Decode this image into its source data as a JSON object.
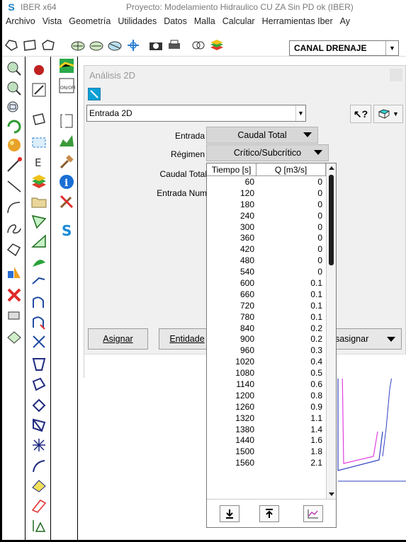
{
  "window": {
    "app_name": "IBER x64",
    "project_title": "Proyecto: Modelamiento Hidraulico CU ZA Sin PD ok (IBER)"
  },
  "menu": [
    "Archivo",
    "Vista",
    "Geometría",
    "Utilidades",
    "Datos",
    "Malla",
    "Calcular",
    "Herramientas Iber",
    "Ay"
  ],
  "toolbar": {
    "layer_combo": "CANAL DRENAJE"
  },
  "dialog": {
    "title": "Análisis 2D",
    "condition_combo": "Entrada 2D",
    "entrada_label": "Entrada",
    "entrada_value": "Caudal Total",
    "regimen_label": "Régimen",
    "regimen_value": "Crítico/Subcrítico",
    "caudal_label": "Caudal Total",
    "entrada_num_label": "Entrada Num",
    "assign_button": "Asignar",
    "entities_button": "Entidade",
    "unassign_button": "Desasignar"
  },
  "table": {
    "col_time": "Tiempo [s]",
    "col_flow": "Q [m3/s]",
    "rows": [
      [
        "60",
        "0"
      ],
      [
        "120",
        "0"
      ],
      [
        "180",
        "0"
      ],
      [
        "240",
        "0"
      ],
      [
        "300",
        "0"
      ],
      [
        "360",
        "0"
      ],
      [
        "420",
        "0"
      ],
      [
        "480",
        "0"
      ],
      [
        "540",
        "0"
      ],
      [
        "600",
        "0.1"
      ],
      [
        "660",
        "0.1"
      ],
      [
        "720",
        "0.1"
      ],
      [
        "780",
        "0.1"
      ],
      [
        "840",
        "0.2"
      ],
      [
        "900",
        "0.2"
      ],
      [
        "960",
        "0.3"
      ],
      [
        "1020",
        "0.4"
      ],
      [
        "1080",
        "0.5"
      ],
      [
        "1140",
        "0.6"
      ],
      [
        "1200",
        "0.8"
      ],
      [
        "1260",
        "0.9"
      ],
      [
        "1320",
        "1.1"
      ],
      [
        "1380",
        "1.4"
      ],
      [
        "1440",
        "1.6"
      ],
      [
        "1500",
        "1.8"
      ],
      [
        "1560",
        "2.1"
      ]
    ]
  },
  "icons": {
    "import": "download-icon",
    "export": "upload-icon",
    "graph": "graph-icon"
  }
}
